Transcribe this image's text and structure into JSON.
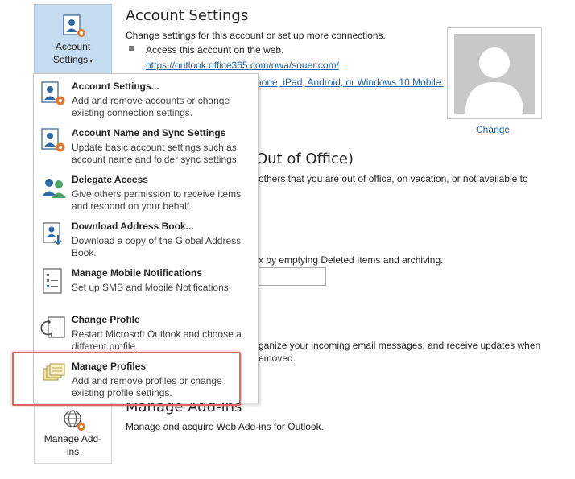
{
  "account_button": {
    "line1": "Account",
    "line2": "Settings",
    "caret": "▾",
    "icon": "person-gear-icon"
  },
  "account_settings": {
    "title": "Account Settings",
    "description": "Change settings for this account or set up more connections.",
    "bullet_text": "Access this account on the web.",
    "web_link": "https://outlook.office365.com/owa/souer.com/",
    "mobile_link_visible": "hone, iPad, Android, or Windows 10 Mobile.",
    "photo_change": "Change"
  },
  "auto_replies": {
    "title_visible": "Out of Office)",
    "desc_visible": "others that you are out of office, on vacation, or not available to"
  },
  "cleanup": {
    "desc_visible": "x by emptying Deleted Items and archiving."
  },
  "rules": {
    "desc_line1_visible": "ganize your incoming email messages, and receive updates when",
    "desc_line2_visible": "emoved."
  },
  "addins": {
    "title": "Manage Add-ins",
    "description": "Manage and acquire Web Add-ins for Outlook.",
    "button_line1": "Manage Add-",
    "button_line2": "ins",
    "icon": "globe-gear-icon"
  },
  "menu": {
    "items": [
      {
        "title": "Account Settings...",
        "desc": "Add and remove accounts or change existing connection settings.",
        "icon": "account-settings-icon"
      },
      {
        "title": "Account Name and Sync Settings",
        "desc": "Update basic account settings such as account name and folder sync settings.",
        "icon": "sync-settings-icon"
      },
      {
        "title": "Delegate Access",
        "desc": "Give others permission to receive items and respond on your behalf.",
        "icon": "delegate-icon"
      },
      {
        "title": "Download Address Book...",
        "desc": "Download a copy of the Global Address Book.",
        "icon": "address-book-icon"
      },
      {
        "title": "Manage Mobile Notifications",
        "desc": "Set up SMS and Mobile Notifications.",
        "icon": "mobile-notifications-icon"
      },
      {
        "title": "Change Profile",
        "desc": "Restart Microsoft Outlook and choose a different profile.",
        "icon": "change-profile-icon"
      },
      {
        "title": "Manage Profiles",
        "desc": "Add and remove profiles or change existing profile settings.",
        "icon": "manage-profiles-icon"
      }
    ]
  }
}
